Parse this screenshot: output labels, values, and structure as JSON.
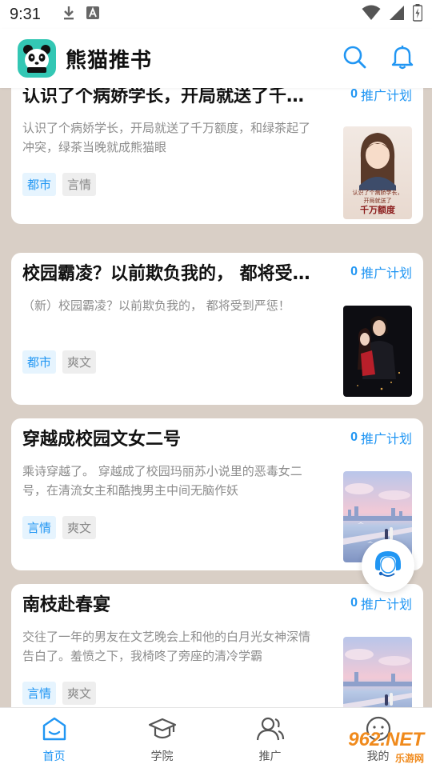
{
  "status_bar": {
    "time": "9:31"
  },
  "header": {
    "app_name": "熊猫推书"
  },
  "colors": {
    "accent": "#2196f3",
    "logo_bg": "#33c7b4",
    "feed_bg": "#d9cfc6"
  },
  "cards": [
    {
      "title": "认识了个病娇学长，开局就送了千万额度",
      "plan_count": "0",
      "plan_label": "推广计划",
      "desc": "认识了个病娇学长，开局就送了千万额度，和绿茶起了冲突，绿茶当晚就成熊猫眼",
      "tags": [
        "都市",
        "言情"
      ],
      "cover_text_1": "认识了个病娇学长，",
      "cover_text_2": "开局就送了",
      "cover_text_3": "千万额度"
    },
    {
      "title": "校园霸凌？以前欺负我的， 都将受到严惩",
      "plan_count": "0",
      "plan_label": "推广计划",
      "desc": "（新）校园霸凌？以前欺负我的， 都将受到严惩！",
      "tags": [
        "都市",
        "爽文"
      ]
    },
    {
      "title": "穿越成校园文女二号",
      "plan_count": "0",
      "plan_label": "推广计划",
      "desc": "乘诗穿越了。 穿越成了校园玛丽苏小说里的恶毒女二号，在清流女主和酷拽男主中间无脑作妖",
      "tags": [
        "言情",
        "爽文"
      ]
    },
    {
      "title": "南枝赴春宴",
      "plan_count": "0",
      "plan_label": "推广计划",
      "desc": "交往了一年的男友在文艺晚会上和他的白月光女神深情告白了。羞愤之下，我椅咚了旁座的清冷学霸",
      "tags": [
        "言情",
        "爽文"
      ]
    }
  ],
  "bottom_nav": [
    {
      "label": "首页",
      "icon": "home-icon",
      "active": true
    },
    {
      "label": "学院",
      "icon": "graduation-cap-icon",
      "active": false
    },
    {
      "label": "推广",
      "icon": "users-icon",
      "active": false
    },
    {
      "label": "我的",
      "icon": "profile-icon",
      "active": false
    }
  ],
  "watermark": {
    "big": "962.NET",
    "small": "乐游网"
  }
}
